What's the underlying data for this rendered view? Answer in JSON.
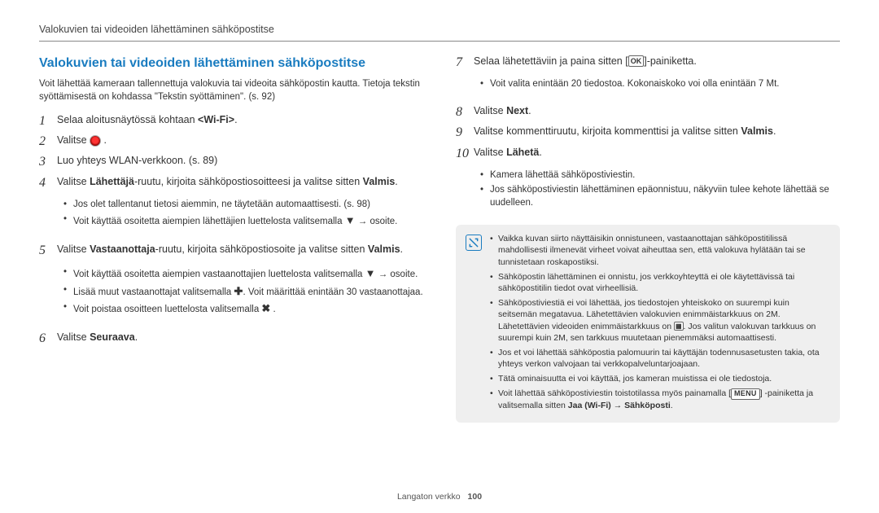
{
  "header": {
    "breadcrumb": "Valokuvien tai videoiden lähettäminen sähköpostitse"
  },
  "title": "Valokuvien tai videoiden lähettäminen sähköpostitse",
  "intro": "Voit lähettää kameraan tallennettuja valokuvia tai videoita sähköpostin kautta. Tietoja tekstin syöttämisestä on kohdassa \"Tekstin syöttäminen\". (s. 92)",
  "steps_left": [
    {
      "n": "1",
      "html": "Selaa aloitusnäytössä kohtaan <b>&lt;Wi-Fi&gt;</b>."
    },
    {
      "n": "2",
      "html": "Valitse <span class=\"icon icon-round\" data-name=\"email-app-icon\" data-interactable=\"false\">@</span> ."
    },
    {
      "n": "3",
      "html": "Luo yhteys WLAN-verkkoon. (s. 89)"
    },
    {
      "n": "4",
      "html": "Valitse <b>Lähettäjä</b>-ruutu, kirjoita sähköpostiosoitteesi ja valitse sitten <b>Valmis</b>.",
      "sub": [
        "Jos olet tallentanut tietosi aiemmin, ne täytetään automaattisesti. (s. 98)",
        "Voit käyttää osoitetta aiempien lähettäjien luettelosta valitsemalla <span class=\"icon-plain\" data-name=\"down-icon\" data-interactable=\"false\">▼</span> → osoite."
      ]
    },
    {
      "n": "5",
      "html": "Valitse <b>Vastaanottaja</b>-ruutu, kirjoita sähköpostiosoite ja valitse sitten <b>Valmis</b>.",
      "sub": [
        "Voit käyttää osoitetta aiempien vastaanottajien luettelosta valitsemalla <span class=\"icon-plain\" data-name=\"down-icon\" data-interactable=\"false\">▼</span> → osoite.",
        "Lisää muut vastaanottajat valitsemalla <span class=\"icon-plain\" data-name=\"plus-icon\" data-interactable=\"false\">✚</span>. Voit määrittää enintään 30 vastaanottajaa.",
        "Voit poistaa osoitteen luettelosta valitsemalla <span class=\"icon-plain\" data-name=\"delete-icon\" data-interactable=\"false\">✖</span> ."
      ]
    },
    {
      "n": "6",
      "html": "Valitse <b>Seuraava</b>."
    }
  ],
  "steps_right": [
    {
      "n": "7",
      "html": "Selaa lähetettäviin ja paina sitten [<span class=\"icon\" data-name=\"ok-button-icon\" data-interactable=\"false\">OK</span>]-painiketta.",
      "sub": [
        "Voit valita enintään 20 tiedostoa. Kokonaiskoko voi olla enintään 7 Mt."
      ]
    },
    {
      "n": "8",
      "html": "Valitse <b>Next</b>."
    },
    {
      "n": "9",
      "html": "Valitse kommenttiruutu, kirjoita kommenttisi ja valitse sitten <b>Valmis</b>."
    },
    {
      "n": "10",
      "html": "Valitse <b>Lähetä</b>.",
      "sub": [
        "Kamera lähettää sähköpostiviestin.",
        "Jos sähköpostiviestin lähettäminen epäonnistuu, näkyviin tulee kehote lähettää se uudelleen."
      ]
    }
  ],
  "notes": [
    "Vaikka kuvan siirto näyttäisikin onnistuneen, vastaanottajan sähköpostitilissä mahdollisesti ilmenevät virheet voivat aiheuttaa sen, että valokuva hylätään tai se tunnistetaan roskapostiksi.",
    "Sähköpostin lähettäminen ei onnistu, jos verkkoyhteyttä ei ole käytettävissä tai sähköpostitilin tiedot ovat virheellisiä.",
    "Sähköpostiviestiä ei voi lähettää, jos tiedostojen yhteiskoko on suurempi kuin seitsemän megatavua. Lähetettävien valokuvien enimmäistarkkuus on 2M. Lähetettävien videoiden enimmäistarkkuus on <span class=\"icon icon-tiny\" data-name=\"video-res-icon\" data-interactable=\"false\">▦</span>. Jos valitun valokuvan tarkkuus on suurempi kuin 2M, sen tarkkuus muutetaan pienemmäksi automaattisesti.",
    "Jos et voi lähettää sähköpostia palomuurin tai käyttäjän todennusasetusten takia, ota yhteys verkon valvojaan tai verkkopalveluntarjoajaan.",
    "Tätä ominaisuutta ei voi käyttää, jos kameran muistissa ei ole tiedostoja.",
    "Voit lähettää sähköpostiviestin toistotilassa myös painamalla [<span class=\"icon icon-menu\" data-name=\"menu-button-icon\" data-interactable=\"false\">MENU</span>] -painiketta ja valitsemalla sitten <b>Jaa (Wi-Fi)</b> → <b>Sähköposti</b>."
  ],
  "footer": {
    "section": "Langaton verkko",
    "page": "100"
  }
}
